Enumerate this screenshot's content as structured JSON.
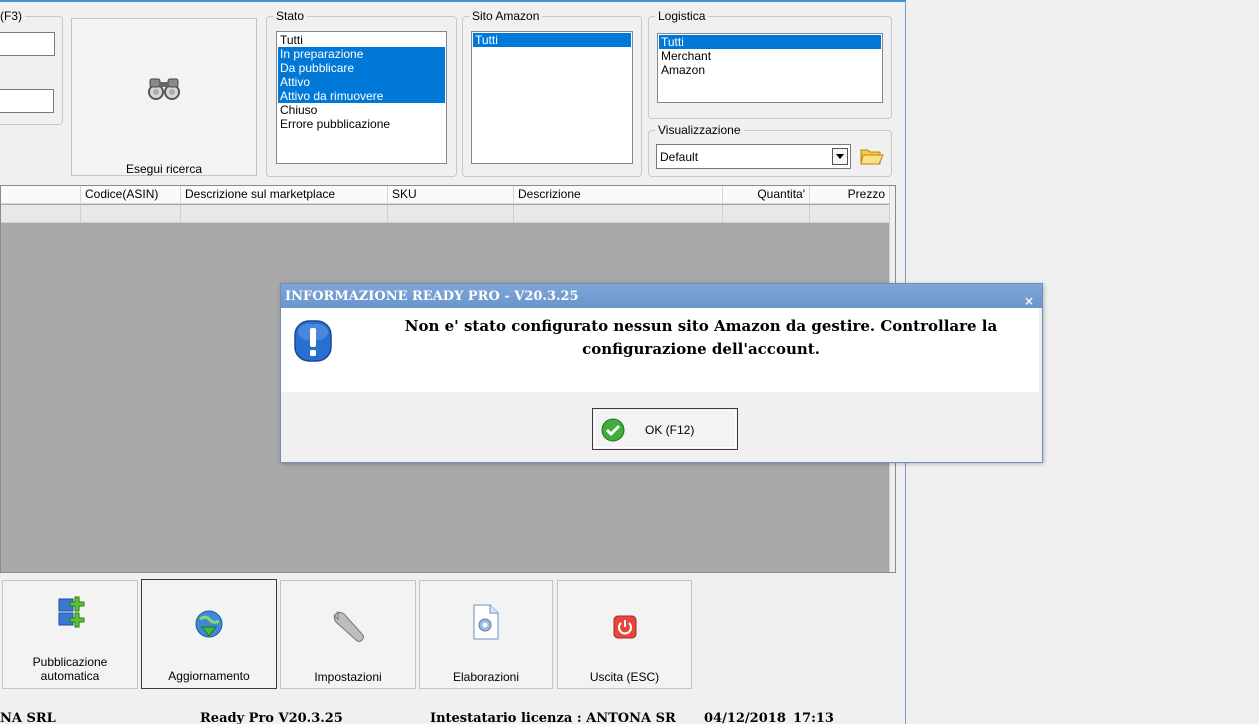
{
  "search": {
    "f3_label": "(F3)",
    "field1_value": "",
    "field2_value": "",
    "button_label": "Esegui ricerca"
  },
  "stato": {
    "legend": "Stato",
    "items": [
      {
        "label": "Tutti",
        "selected": false
      },
      {
        "label": "In preparazione",
        "selected": true
      },
      {
        "label": "Da pubblicare",
        "selected": true
      },
      {
        "label": "Attivo",
        "selected": true
      },
      {
        "label": "Attivo da rimuovere",
        "selected": true
      },
      {
        "label": "Chiuso",
        "selected": false
      },
      {
        "label": "Errore pubblicazione",
        "selected": false
      }
    ]
  },
  "sito": {
    "legend": "Sito Amazon",
    "items": [
      {
        "label": "Tutti",
        "selected": true
      }
    ]
  },
  "logistica": {
    "legend": "Logistica",
    "items": [
      {
        "label": "Tutti",
        "selected": true
      },
      {
        "label": "Merchant",
        "selected": false
      },
      {
        "label": "Amazon",
        "selected": false
      }
    ]
  },
  "visualizzazione": {
    "legend": "Visualizzazione",
    "value": "Default"
  },
  "grid": {
    "columns": [
      "Codice(ASIN)",
      "Descrizione sul marketplace",
      "SKU",
      "Descrizione",
      "Quantita'",
      "Prezzo"
    ]
  },
  "toolbar": {
    "pubblicazione": "Pubblicazione automatica",
    "pubblicazione_l1": "Pubblicazione",
    "pubblicazione_l2": "automatica",
    "aggiornamento": "Aggiornamento",
    "impostazioni": "Impostazioni",
    "elaborazioni": "Elaborazioni",
    "uscita": "Uscita (ESC)"
  },
  "statusbar": {
    "company": "NA SRL",
    "version": "Ready Pro V20.3.25",
    "license": "Intestatario licenza : ANTONA SR",
    "date": "04/12/2018",
    "time": "17:13"
  },
  "dialog": {
    "title": "INFORMAZIONE READY PRO - V20.3.25",
    "close": "×",
    "message_line1": "Non e' stato configurato nessun sito Amazon da gestire. Controllare la",
    "message_line2": "configurazione dell'account.",
    "ok_label": "OK (F12)"
  },
  "colors": {
    "selection": "#0078d7",
    "dialog_title": "#6a95cc",
    "grid_bg": "#a9a9a9"
  }
}
